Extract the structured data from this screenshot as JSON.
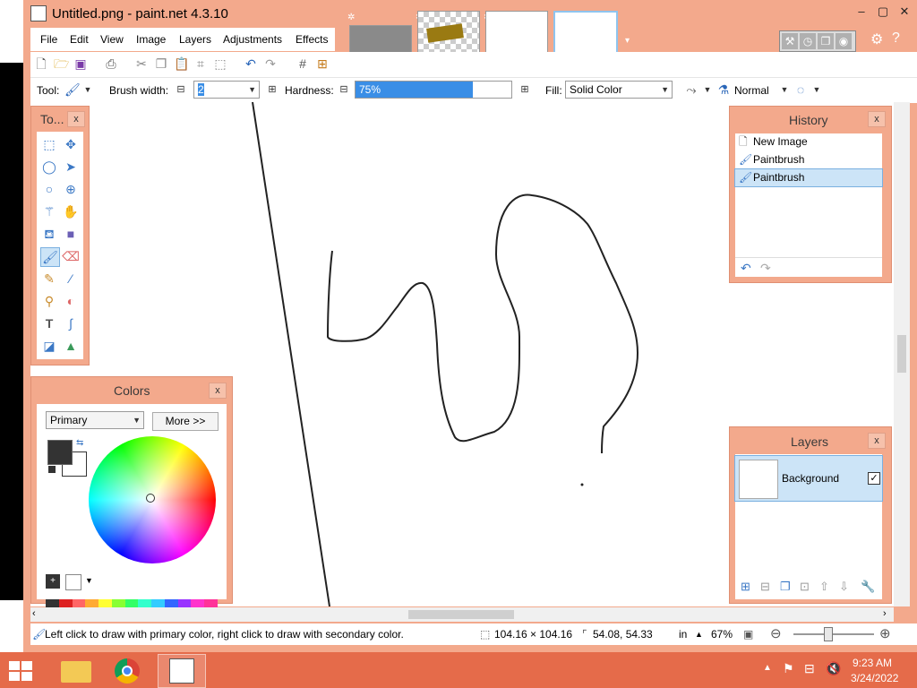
{
  "window": {
    "title": "Untitled.png - paint.net 4.3.10",
    "minimize": "–",
    "maximize": "▢",
    "close": "✕"
  },
  "menu": [
    "File",
    "Edit",
    "View",
    "Image",
    "Layers",
    "Adjustments",
    "Effects"
  ],
  "toolbar": {
    "tool_label": "Tool:",
    "brush_width_label": "Brush width:",
    "brush_width_value": "2",
    "hardness_label": "Hardness:",
    "hardness_value": "75%",
    "hardness_level": 0.75,
    "fill_label": "Fill:",
    "fill_value": "Solid Color",
    "blend_value": "Normal"
  },
  "tools_panel": {
    "title": "To...",
    "close": "x"
  },
  "colors_panel": {
    "title": "Colors",
    "close": "x",
    "mode": "Primary",
    "more_button": "More >>",
    "primary_color": "#333333",
    "secondary_color": "#ffffff"
  },
  "history_panel": {
    "title": "History",
    "close": "x",
    "items": [
      "New Image",
      "Paintbrush",
      "Paintbrush"
    ]
  },
  "layers_panel": {
    "title": "Layers",
    "close": "x",
    "layer_name": "Background",
    "visible_checkbox": "✓"
  },
  "status": {
    "hint": "Left click to draw with primary color, right click to draw with secondary color.",
    "selection_size": "104.16 × 104.16",
    "cursor_pos": "54.08, 54.33",
    "unit": "in",
    "zoom": "67%"
  },
  "taskbar": {
    "time": "9:23 AM",
    "date": "3/24/2022"
  },
  "colors": {
    "accent": "#f3a98c",
    "taskbar": "#e56b4a",
    "selection": "#cce4f7",
    "hardness_fill": "#3a8ee6"
  }
}
